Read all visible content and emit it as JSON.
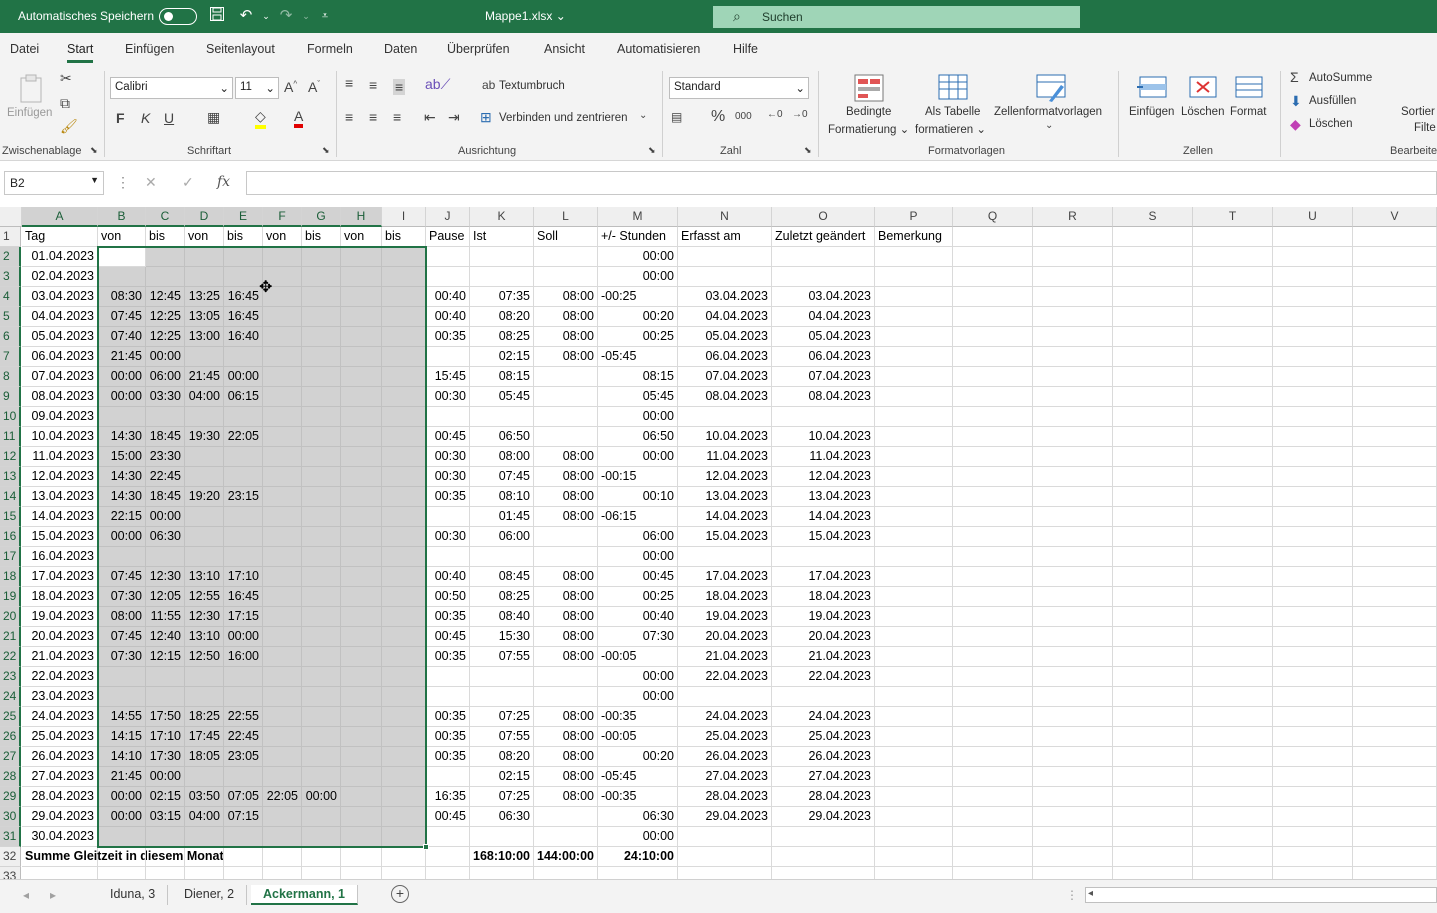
{
  "titlebar": {
    "autosave_label": "Automatisches Speichern",
    "filename": "Mappe1.xlsx",
    "search_placeholder": "Suchen"
  },
  "menu_tabs": [
    "Datei",
    "Start",
    "Einfügen",
    "Seitenlayout",
    "Formeln",
    "Daten",
    "Überprüfen",
    "Ansicht",
    "Automatisieren",
    "Hilfe"
  ],
  "active_menu_tab": "Start",
  "ribbon": {
    "clipboard": {
      "paste_label": "Einfügen",
      "group_label": "Zwischenablage"
    },
    "font": {
      "font_name": "Calibri",
      "font_size": "11",
      "group_label": "Schriftart",
      "bold": "F",
      "italic": "K",
      "underline": "U"
    },
    "alignment": {
      "wrap_text": "Textumbruch",
      "merge_center": "Verbinden und zentrieren",
      "group_label": "Ausrichtung"
    },
    "number": {
      "format": "Standard",
      "group_label": "Zahl"
    },
    "styles": {
      "conditional_1": "Bedingte",
      "conditional_2": "Formatierung",
      "table_1": "Als Tabelle",
      "table_2": "formatieren",
      "cell_styles": "Zellenformatvorlagen",
      "group_label": "Formatvorlagen"
    },
    "cells": {
      "insert": "Einfügen",
      "delete": "Löschen",
      "format": "Format",
      "group_label": "Zellen"
    },
    "editing": {
      "autosum": "AutoSumme",
      "fill": "Ausfüllen",
      "clear": "Löschen",
      "sort_1": "Sortier",
      "sort_2": "Filte",
      "group_label": "Bearbeite"
    }
  },
  "formula_bar": {
    "name_box": "B2",
    "fx": "fx",
    "value": ""
  },
  "columns": [
    "A",
    "B",
    "C",
    "D",
    "E",
    "F",
    "G",
    "H",
    "I",
    "J",
    "K",
    "L",
    "M",
    "N",
    "O",
    "P",
    "Q",
    "R",
    "S",
    "T",
    "U",
    "V"
  ],
  "header_row": [
    "Tag",
    "von",
    "bis",
    "von",
    "bis",
    "von",
    "bis",
    "von",
    "bis",
    "Pause",
    "Ist",
    "Soll",
    "+/- Stunden",
    "Erfasst am",
    "Zuletzt geändert",
    "Bemerkung"
  ],
  "rows": [
    [
      "01.04.2023",
      "",
      "",
      "",
      "",
      "",
      "",
      "",
      "",
      "",
      "",
      "",
      "00:00",
      "",
      ""
    ],
    [
      "02.04.2023",
      "",
      "",
      "",
      "",
      "",
      "",
      "",
      "",
      "",
      "",
      "",
      "00:00",
      "",
      ""
    ],
    [
      "03.04.2023",
      "08:30",
      "12:45",
      "13:25",
      "16:45",
      "",
      "",
      "",
      "",
      "00:40",
      "07:35",
      "08:00",
      "-00:25",
      "03.04.2023",
      "03.04.2023"
    ],
    [
      "04.04.2023",
      "07:45",
      "12:25",
      "13:05",
      "16:45",
      "",
      "",
      "",
      "",
      "00:40",
      "08:20",
      "08:00",
      "00:20",
      "04.04.2023",
      "04.04.2023"
    ],
    [
      "05.04.2023",
      "07:40",
      "12:25",
      "13:00",
      "16:40",
      "",
      "",
      "",
      "",
      "00:35",
      "08:25",
      "08:00",
      "00:25",
      "05.04.2023",
      "05.04.2023"
    ],
    [
      "06.04.2023",
      "21:45",
      "00:00",
      "",
      "",
      "",
      "",
      "",
      "",
      "",
      "02:15",
      "08:00",
      "-05:45",
      "06.04.2023",
      "06.04.2023"
    ],
    [
      "07.04.2023",
      "00:00",
      "06:00",
      "21:45",
      "00:00",
      "",
      "",
      "",
      "",
      "15:45",
      "08:15",
      "",
      "08:15",
      "07.04.2023",
      "07.04.2023"
    ],
    [
      "08.04.2023",
      "00:00",
      "03:30",
      "04:00",
      "06:15",
      "",
      "",
      "",
      "",
      "00:30",
      "05:45",
      "",
      "05:45",
      "08.04.2023",
      "08.04.2023"
    ],
    [
      "09.04.2023",
      "",
      "",
      "",
      "",
      "",
      "",
      "",
      "",
      "",
      "",
      "",
      "00:00",
      "",
      ""
    ],
    [
      "10.04.2023",
      "14:30",
      "18:45",
      "19:30",
      "22:05",
      "",
      "",
      "",
      "",
      "00:45",
      "06:50",
      "",
      "06:50",
      "10.04.2023",
      "10.04.2023"
    ],
    [
      "11.04.2023",
      "15:00",
      "23:30",
      "",
      "",
      "",
      "",
      "",
      "",
      "00:30",
      "08:00",
      "08:00",
      "00:00",
      "11.04.2023",
      "11.04.2023"
    ],
    [
      "12.04.2023",
      "14:30",
      "22:45",
      "",
      "",
      "",
      "",
      "",
      "",
      "00:30",
      "07:45",
      "08:00",
      "-00:15",
      "12.04.2023",
      "12.04.2023"
    ],
    [
      "13.04.2023",
      "14:30",
      "18:45",
      "19:20",
      "23:15",
      "",
      "",
      "",
      "",
      "00:35",
      "08:10",
      "08:00",
      "00:10",
      "13.04.2023",
      "13.04.2023"
    ],
    [
      "14.04.2023",
      "22:15",
      "00:00",
      "",
      "",
      "",
      "",
      "",
      "",
      "",
      "01:45",
      "08:00",
      "-06:15",
      "14.04.2023",
      "14.04.2023"
    ],
    [
      "15.04.2023",
      "00:00",
      "06:30",
      "",
      "",
      "",
      "",
      "",
      "",
      "00:30",
      "06:00",
      "",
      "06:00",
      "15.04.2023",
      "15.04.2023"
    ],
    [
      "16.04.2023",
      "",
      "",
      "",
      "",
      "",
      "",
      "",
      "",
      "",
      "",
      "",
      "00:00",
      "",
      ""
    ],
    [
      "17.04.2023",
      "07:45",
      "12:30",
      "13:10",
      "17:10",
      "",
      "",
      "",
      "",
      "00:40",
      "08:45",
      "08:00",
      "00:45",
      "17.04.2023",
      "17.04.2023"
    ],
    [
      "18.04.2023",
      "07:30",
      "12:05",
      "12:55",
      "16:45",
      "",
      "",
      "",
      "",
      "00:50",
      "08:25",
      "08:00",
      "00:25",
      "18.04.2023",
      "18.04.2023"
    ],
    [
      "19.04.2023",
      "08:00",
      "11:55",
      "12:30",
      "17:15",
      "",
      "",
      "",
      "",
      "00:35",
      "08:40",
      "08:00",
      "00:40",
      "19.04.2023",
      "19.04.2023"
    ],
    [
      "20.04.2023",
      "07:45",
      "12:40",
      "13:10",
      "00:00",
      "",
      "",
      "",
      "",
      "00:45",
      "15:30",
      "08:00",
      "07:30",
      "20.04.2023",
      "20.04.2023"
    ],
    [
      "21.04.2023",
      "07:30",
      "12:15",
      "12:50",
      "16:00",
      "",
      "",
      "",
      "",
      "00:35",
      "07:55",
      "08:00",
      "-00:05",
      "21.04.2023",
      "21.04.2023"
    ],
    [
      "22.04.2023",
      "",
      "",
      "",
      "",
      "",
      "",
      "",
      "",
      "",
      "",
      "",
      "00:00",
      "22.04.2023",
      "22.04.2023"
    ],
    [
      "23.04.2023",
      "",
      "",
      "",
      "",
      "",
      "",
      "",
      "",
      "",
      "",
      "",
      "00:00",
      "",
      ""
    ],
    [
      "24.04.2023",
      "14:55",
      "17:50",
      "18:25",
      "22:55",
      "",
      "",
      "",
      "",
      "00:35",
      "07:25",
      "08:00",
      "-00:35",
      "24.04.2023",
      "24.04.2023"
    ],
    [
      "25.04.2023",
      "14:15",
      "17:10",
      "17:45",
      "22:45",
      "",
      "",
      "",
      "",
      "00:35",
      "07:55",
      "08:00",
      "-00:05",
      "25.04.2023",
      "25.04.2023"
    ],
    [
      "26.04.2023",
      "14:10",
      "17:30",
      "18:05",
      "23:05",
      "",
      "",
      "",
      "",
      "00:35",
      "08:20",
      "08:00",
      "00:20",
      "26.04.2023",
      "26.04.2023"
    ],
    [
      "27.04.2023",
      "21:45",
      "00:00",
      "",
      "",
      "",
      "",
      "",
      "",
      "",
      "02:15",
      "08:00",
      "-05:45",
      "27.04.2023",
      "27.04.2023"
    ],
    [
      "28.04.2023",
      "00:00",
      "02:15",
      "03:50",
      "07:05",
      "22:05",
      "00:00",
      "",
      "",
      "16:35",
      "07:25",
      "08:00",
      "-00:35",
      "28.04.2023",
      "28.04.2023"
    ],
    [
      "29.04.2023",
      "00:00",
      "03:15",
      "04:00",
      "07:15",
      "",
      "",
      "",
      "",
      "00:45",
      "06:30",
      "",
      "06:30",
      "29.04.2023",
      "29.04.2023"
    ],
    [
      "30.04.2023",
      "",
      "",
      "",
      "",
      "",
      "",
      "",
      "",
      "",
      "",
      "",
      "00:00",
      "",
      ""
    ]
  ],
  "summary_row": {
    "label": "Summe Gleitzeit in diesem Monat",
    "ist": "168:10:00",
    "soll": "144:00:00",
    "diff": "24:10:00"
  },
  "sheet_tabs": [
    "Iduna, 3",
    "Diener, 2",
    "Ackermann, 1"
  ],
  "active_sheet": "Ackermann, 1",
  "colors": {
    "accent": "#217346",
    "selection": "#d2d2d2"
  }
}
